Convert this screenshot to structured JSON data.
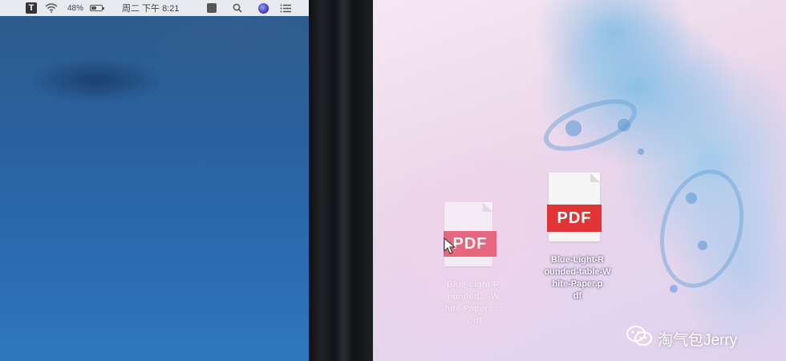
{
  "menubar": {
    "app_icon_letter": "T",
    "battery_percent": "48%",
    "datetime": "周二 下午 8:21",
    "icons": [
      "t-app-icon",
      "wifi-icon",
      "battery-icon",
      "square-icon",
      "search-icon",
      "siri-icon",
      "menu-icon"
    ]
  },
  "desktop": {
    "files": [
      {
        "name": "dragging-pdf",
        "badge": "PDF",
        "label": "Blue-Light-R\nounded…-W\nhite-Papers…\n…df",
        "state": "dragging"
      },
      {
        "name": "pdf-file",
        "badge": "PDF",
        "label": "Blue-Light-R\nounded-table-W\nhite-Paper.p\ndf",
        "state": "normal"
      }
    ]
  },
  "watermark": {
    "text": "淘气包Jerry",
    "icon": "wechat-icon"
  },
  "colors": {
    "pdf_red": "#e23434",
    "dragging_pdf_red": "#e5435a",
    "menubar_bg": "#f5f5f5"
  }
}
